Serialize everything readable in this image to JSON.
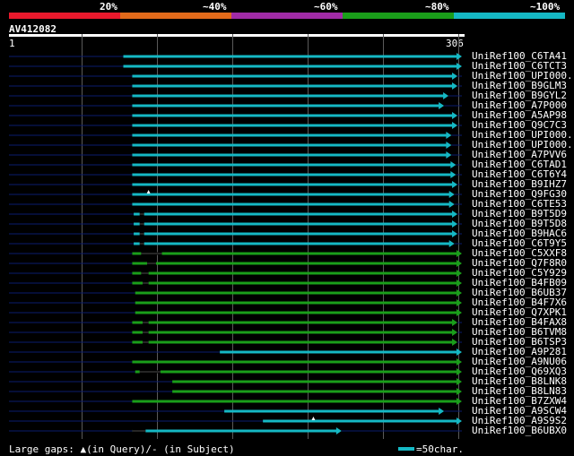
{
  "identity_legend": [
    {
      "label": "20%",
      "color": "#e8192c"
    },
    {
      "label": "~40%",
      "color": "#e26a1a"
    },
    {
      "label": "~60%",
      "color": "#a02ba6"
    },
    {
      "label": "~80%",
      "color": "#1a9e1a"
    },
    {
      "label": "~100%",
      "color": "#15b8c4"
    }
  ],
  "query": {
    "name": "AV412082",
    "start": "1",
    "end": "306"
  },
  "colors": {
    "background": "#000000",
    "ruler": "#ffffff",
    "unaligned": "#0a1b6e",
    "gap_line": "#4b4b4b",
    "cyan": "#15b8c4",
    "green": "#1a9e1a"
  },
  "hits": [
    {
      "label": "UniRef100_C6TA41",
      "start": 78,
      "end": 306,
      "color": "cyan"
    },
    {
      "label": "UniRef100_C6TCT3",
      "start": 78,
      "end": 306,
      "color": "cyan"
    },
    {
      "label": "UniRef100_UPI000..",
      "start": 84,
      "end": 303,
      "color": "cyan"
    },
    {
      "label": "UniRef100_B9GLM3",
      "start": 84,
      "end": 303,
      "color": "cyan"
    },
    {
      "label": "UniRef100_B9GYL2",
      "start": 84,
      "end": 297,
      "color": "cyan"
    },
    {
      "label": "UniRef100_A7P000",
      "start": 84,
      "end": 294,
      "color": "cyan"
    },
    {
      "label": "UniRef100_A5AP98",
      "start": 84,
      "end": 303,
      "color": "cyan"
    },
    {
      "label": "UniRef100_Q9C7C3",
      "start": 84,
      "end": 303,
      "color": "cyan"
    },
    {
      "label": "UniRef100_UPI000..",
      "start": 84,
      "end": 299,
      "color": "cyan"
    },
    {
      "label": "UniRef100_UPI000..",
      "start": 84,
      "end": 299,
      "color": "cyan"
    },
    {
      "label": "UniRef100_A7PVV6",
      "start": 84,
      "end": 299,
      "color": "cyan"
    },
    {
      "label": "UniRef100_C6TAD1",
      "start": 84,
      "end": 302,
      "color": "cyan"
    },
    {
      "label": "UniRef100_C6T6Y4",
      "start": 84,
      "end": 302,
      "color": "cyan"
    },
    {
      "label": "UniRef100_B9IHZ7",
      "start": 84,
      "end": 303,
      "color": "cyan"
    },
    {
      "label": "UniRef100_Q9FG30",
      "start": 84,
      "end": 301,
      "color": "cyan",
      "qgap": 95
    },
    {
      "label": "UniRef100_C6TE53",
      "start": 84,
      "end": 301,
      "color": "cyan"
    },
    {
      "label": "UniRef100_B9T5D9",
      "start": 85,
      "end": 303,
      "color": "cyan",
      "sgap": [
        89,
        92
      ]
    },
    {
      "label": "UniRef100_B9T5D8",
      "start": 85,
      "end": 303,
      "color": "cyan",
      "sgap": [
        89,
        92
      ]
    },
    {
      "label": "UniRef100_B9HAC6",
      "start": 85,
      "end": 303,
      "color": "cyan",
      "sgap": [
        89,
        92
      ]
    },
    {
      "label": "UniRef100_C6T9Y5",
      "start": 85,
      "end": 301,
      "color": "cyan",
      "sgap": [
        89,
        92
      ]
    },
    {
      "label": "UniRef100_C5XXF8",
      "start": 84,
      "end": 306,
      "color": "green",
      "sgap": [
        90,
        104
      ]
    },
    {
      "label": "UniRef100_Q7F8R0",
      "start": 84,
      "end": 306,
      "color": "green",
      "sgap": [
        94,
        100
      ]
    },
    {
      "label": "UniRef100_C5Y929",
      "start": 84,
      "end": 306,
      "color": "green",
      "sgap": [
        90,
        95
      ]
    },
    {
      "label": "UniRef100_B4FB09",
      "start": 84,
      "end": 306,
      "color": "green",
      "sgap": [
        91,
        95
      ]
    },
    {
      "label": "UniRef100_B6UB37",
      "start": 86,
      "end": 306,
      "color": "green"
    },
    {
      "label": "UniRef100_B4F7X6",
      "start": 86,
      "end": 306,
      "color": "green"
    },
    {
      "label": "UniRef100_Q7XPK1",
      "start": 86,
      "end": 306,
      "color": "green"
    },
    {
      "label": "UniRef100_B4FAX8",
      "start": 84,
      "end": 303,
      "color": "green",
      "sgap": [
        91,
        95
      ]
    },
    {
      "label": "UniRef100_B6TVM8",
      "start": 84,
      "end": 303,
      "color": "green",
      "sgap": [
        91,
        95
      ]
    },
    {
      "label": "UniRef100_B6TSP3",
      "start": 84,
      "end": 303,
      "color": "green",
      "sgap": [
        91,
        95
      ]
    },
    {
      "label": "UniRef100_A9P281",
      "start": 143,
      "end": 306,
      "color": "cyan"
    },
    {
      "label": "UniRef100_A9NU06",
      "start": 84,
      "end": 306,
      "color": "green"
    },
    {
      "label": "UniRef100_Q69XQ3",
      "start": 86,
      "end": 306,
      "color": "green",
      "sgap": [
        89,
        103
      ]
    },
    {
      "label": "UniRef100_B8LNK8",
      "start": 111,
      "end": 306,
      "color": "green"
    },
    {
      "label": "UniRef100_B8LN83",
      "start": 111,
      "end": 306,
      "color": "green"
    },
    {
      "label": "UniRef100_B7ZXW4",
      "start": 84,
      "end": 306,
      "color": "green"
    },
    {
      "label": "UniRef100_A9SCW4",
      "start": 146,
      "end": 294,
      "color": "cyan"
    },
    {
      "label": "UniRef100_A9S9S2",
      "start": 172,
      "end": 306,
      "color": "cyan",
      "qgap": 206
    },
    {
      "label": "UniRef100_B6UBX0",
      "start": 84,
      "end": 225,
      "color": "cyan",
      "sgap": [
        84,
        93
      ]
    }
  ],
  "footer": {
    "text": "Large gaps: ▲(in Query)/- (in Subject)",
    "scale_label": "=50char."
  }
}
